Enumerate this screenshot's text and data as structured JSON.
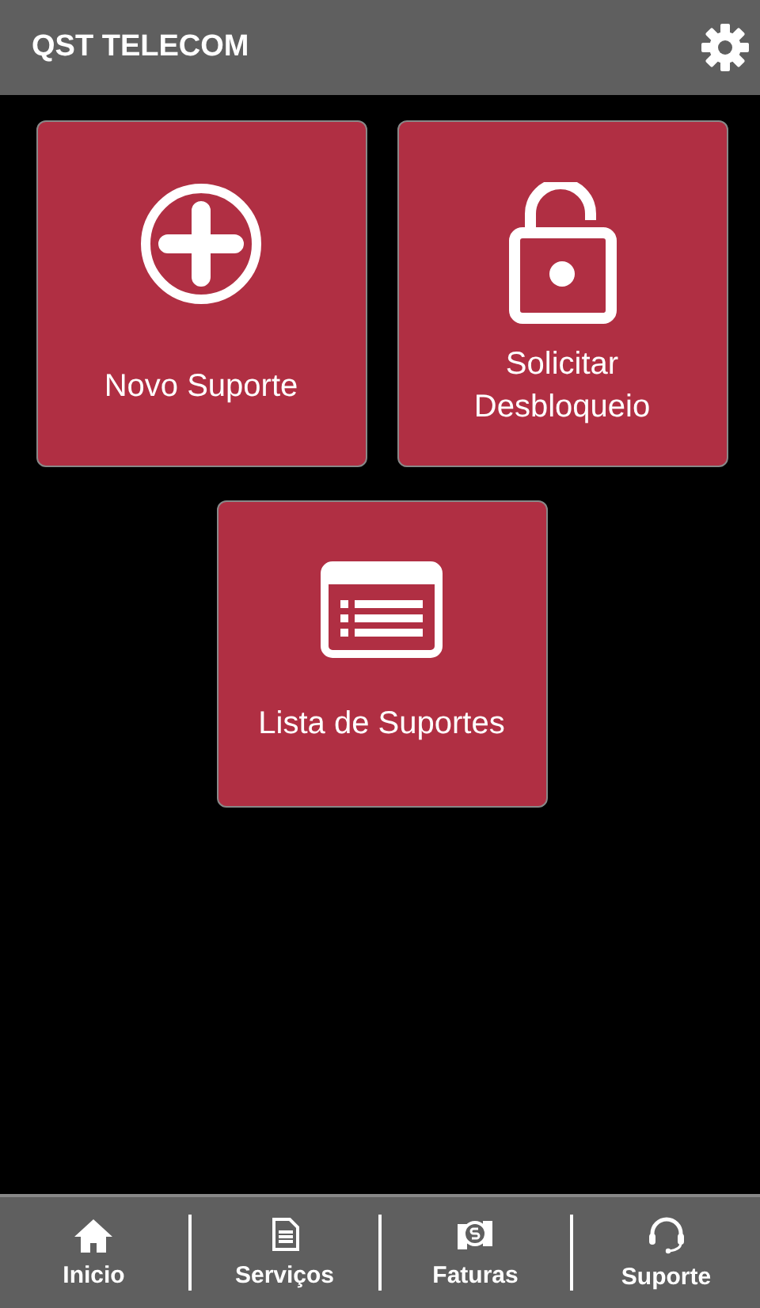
{
  "header": {
    "title": "QST TELECOM"
  },
  "tiles": [
    {
      "kind": "plus",
      "label": "Novo Suporte"
    },
    {
      "kind": "unlock",
      "label": "Solicitar Desbloqueio"
    },
    {
      "kind": "list",
      "label": "Lista de Suportes"
    }
  ],
  "nav": [
    {
      "kind": "home",
      "label": "Inicio"
    },
    {
      "kind": "document",
      "label": "Serviços"
    },
    {
      "kind": "money",
      "label": "Faturas"
    },
    {
      "kind": "headset",
      "label": "Suporte"
    }
  ]
}
